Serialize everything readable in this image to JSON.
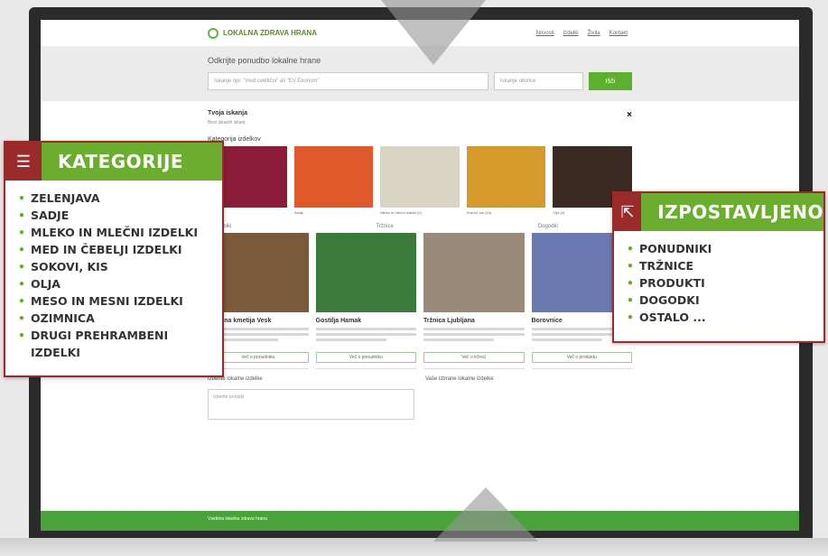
{
  "site": {
    "logo_text": "LOKALNA ZDRAVA HRANA",
    "nav": [
      "Novosti",
      "Izdelki",
      "Živila",
      "Kontakt"
    ],
    "search_title": "Odkrijte ponudbo lokalne hrane",
    "search_placeholder": "Iskanje npr. \"med cvetlični\" ali \"EV Ekonom\"",
    "location_placeholder": "Iskanje okolice",
    "search_button": "Išči",
    "filter_title": "Tvoja iskanja",
    "filter_sub": "Brez iskanih iskanj",
    "close_icon": "×",
    "categories_title": "Kategorija izdelkov",
    "categories": [
      {
        "caption": "Zelenjava",
        "color": "#8b1d3a"
      },
      {
        "caption": "Sadje",
        "color": "#e0592a"
      },
      {
        "caption": "Mleko in mlečni izdelki (2)",
        "color": "#d9d4c4"
      },
      {
        "caption": "Sokovi, kis (16)",
        "color": "#d59a2a"
      },
      {
        "caption": "Olja (4)",
        "color": "#3a2a22"
      }
    ],
    "featured_titles": [
      "Ponudniki",
      "Tržnice",
      "Dogodki"
    ],
    "featured": [
      {
        "title": "Lokalna kmetija Vesk",
        "color": "#7a5a3a",
        "button": "Več o ponudniku"
      },
      {
        "title": "Gostilja Hamak",
        "color": "#3a7a3a",
        "button": "Več o ponudniku"
      },
      {
        "title": "Tržnica Ljubljana",
        "color": "#9a8a7a",
        "button": "Več o tržnici"
      },
      {
        "title": "Borovnice",
        "color": "#6a7ab0",
        "button": "Več o produktu"
      }
    ],
    "bottom_left": "Izberite lokalne izdelke",
    "bottom_left_select": "Izberite produkt",
    "bottom_right": "Vaše izbrane lokalne izdelke",
    "footer_text": "Vsebina lokalna zdrava hrana"
  },
  "callout_left": {
    "title": "KATEGORIJE",
    "icon": "list-icon",
    "items": [
      "ZELENJAVA",
      "SADJE",
      "MLEKO IN MLEČNI IZDELKI",
      "MED IN ČEBELJI IZDELKI",
      "SOKOVI, KIS",
      "OLJA",
      "MESO IN MESNI IZDELKI",
      "OZIMNICA",
      "DRUGI PREHRAMBENI IZDELKI"
    ]
  },
  "callout_right": {
    "title": "IZPOSTAVLJENO",
    "icon": "external-link-icon",
    "items": [
      "PONUDNIKI",
      "TRŽNICE",
      "PRODUKTI",
      "DOGODKI",
      "OSTALO ..."
    ]
  },
  "colors": {
    "green": "#6aad2f",
    "red": "#9b2a2a"
  }
}
